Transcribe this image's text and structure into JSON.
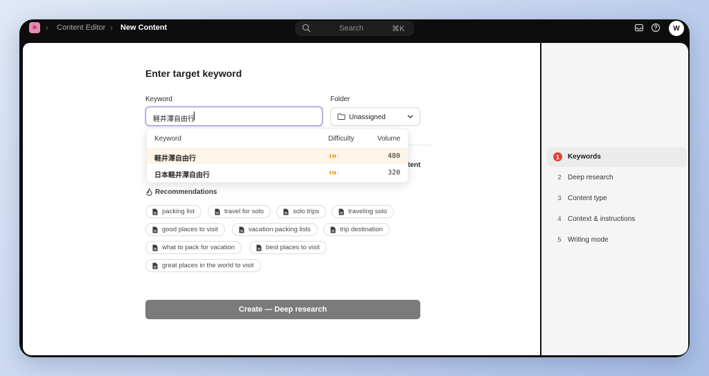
{
  "topbar": {
    "breadcrumb": [
      "Content Editor",
      "New Content"
    ],
    "search_label": "Search",
    "search_shortcut": "⌘K",
    "avatar_initial": "W"
  },
  "form": {
    "title": "Enter target keyword",
    "keyword_label": "Keyword",
    "keyword_value": "軽井澤自由行",
    "folder_label": "Folder",
    "folder_value": "Unassigned",
    "partial_label": "tent"
  },
  "suggestions": {
    "headers": {
      "keyword": "Keyword",
      "difficulty": "Difficulty",
      "volume": "Volume"
    },
    "rows": [
      {
        "keyword": "軽井澤自由行",
        "difficulty_level": 0.75,
        "volume": "480"
      },
      {
        "keyword": "日本軽井澤自由行",
        "difficulty_level": 0.75,
        "volume": "320"
      }
    ]
  },
  "recommendations": {
    "title": "Recommendations",
    "chips": [
      "packing list",
      "travel for solo",
      "solo trips",
      "traveling solo",
      "good places to visit",
      "vacation packing lists",
      "trip destination",
      "what to pack for vacation",
      "best places to visit",
      "great places in the world to visit"
    ]
  },
  "create_button_label": "Create — Deep research",
  "steps": [
    {
      "num": "1",
      "label": "Keywords",
      "active": true
    },
    {
      "num": "2",
      "label": "Deep research",
      "active": false
    },
    {
      "num": "3",
      "label": "Content type",
      "active": false
    },
    {
      "num": "4",
      "label": "Context & instructions",
      "active": false
    },
    {
      "num": "5",
      "label": "Writing mode",
      "active": false
    }
  ],
  "colors": {
    "accent_step": "#e0433b",
    "difficulty": "#e7a027",
    "focus": "#8b86e0"
  }
}
